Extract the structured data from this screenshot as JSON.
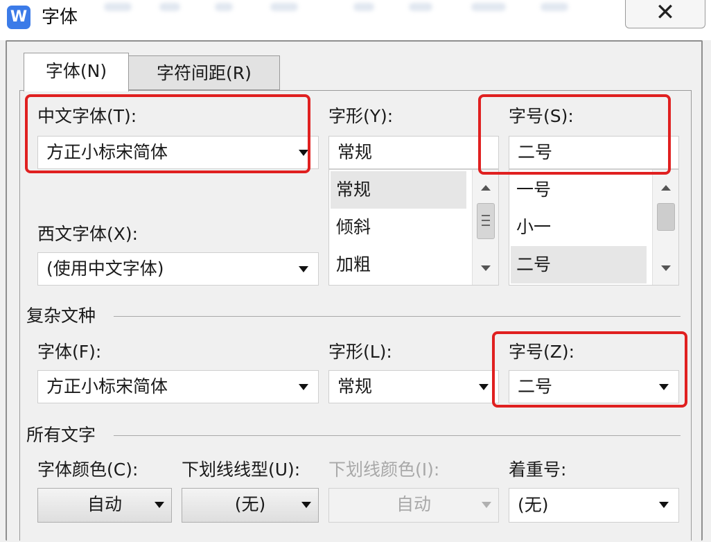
{
  "window": {
    "title": "字体",
    "app_icon": "W",
    "close_label": "✕"
  },
  "tabs": [
    {
      "label": "字体(N)",
      "active": true
    },
    {
      "label": "字符间距(R)",
      "active": false
    }
  ],
  "main_font": {
    "chinese_label": "中文字体(T):",
    "chinese_value": "方正小标宋简体",
    "western_label": "西文字体(X):",
    "western_value": "(使用中文字体)",
    "style_label": "字形(Y):",
    "style_value": "常规",
    "style_options": [
      "常规",
      "倾斜",
      "加粗"
    ],
    "size_label": "字号(S):",
    "size_value": "二号",
    "size_options": [
      "一号",
      "小一",
      "二号"
    ]
  },
  "complex": {
    "section_label": "复杂文种",
    "font_label": "字体(F):",
    "font_value": "方正小标宋简体",
    "style_label": "字形(L):",
    "style_value": "常规",
    "size_label": "字号(Z):",
    "size_value": "二号"
  },
  "all_text": {
    "section_label": "所有文字",
    "color_label": "字体颜色(C):",
    "color_value": "自动",
    "underline_label": "下划线线型(U):",
    "underline_value": "(无)",
    "underline_color_label": "下划线颜色(I):",
    "underline_color_value": "自动",
    "emphasis_label": "着重号:",
    "emphasis_value": "(无)"
  },
  "colors": {
    "highlight_box": "#e02020",
    "app_icon_bg": "#3b7be8"
  }
}
